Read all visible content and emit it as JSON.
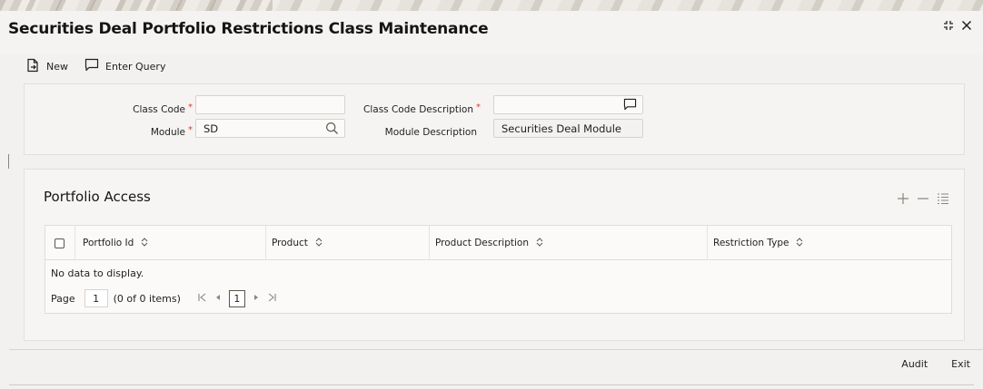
{
  "window": {
    "title": "Securities Deal Portfolio Restrictions Class Maintenance"
  },
  "toolbar": {
    "new_label": "New",
    "enter_query_label": "Enter Query"
  },
  "form": {
    "class_code": {
      "label": "Class Code",
      "value": "",
      "required": "*"
    },
    "class_code_description": {
      "label": "Class Code Description",
      "value": "",
      "required": "*"
    },
    "module": {
      "label": "Module",
      "value": "SD",
      "required": "*"
    },
    "module_description": {
      "label": "Module Description",
      "value": "Securities Deal Module"
    }
  },
  "portfolio_access": {
    "title": "Portfolio Access",
    "columns": [
      "Portfolio Id",
      "Product",
      "Product Description",
      "Restriction Type"
    ],
    "empty_text": "No data to display.",
    "pager": {
      "page_label": "Page",
      "page_value": "1",
      "items_text": "(0 of 0 items)",
      "current_page": "1"
    }
  },
  "footer": {
    "audit_label": "Audit",
    "exit_label": "Exit"
  },
  "colors": {
    "required": "#c74634",
    "text": "#1f1f1f",
    "background": "#f2f1ef"
  },
  "icons": {
    "new": "new-document-icon",
    "enter_query": "speech-bubble-icon",
    "maximize": "expand-icon",
    "close": "close-icon",
    "search": "search-icon",
    "add_row": "plus-icon",
    "delete_row": "minus-icon",
    "single_view": "list-view-icon"
  }
}
